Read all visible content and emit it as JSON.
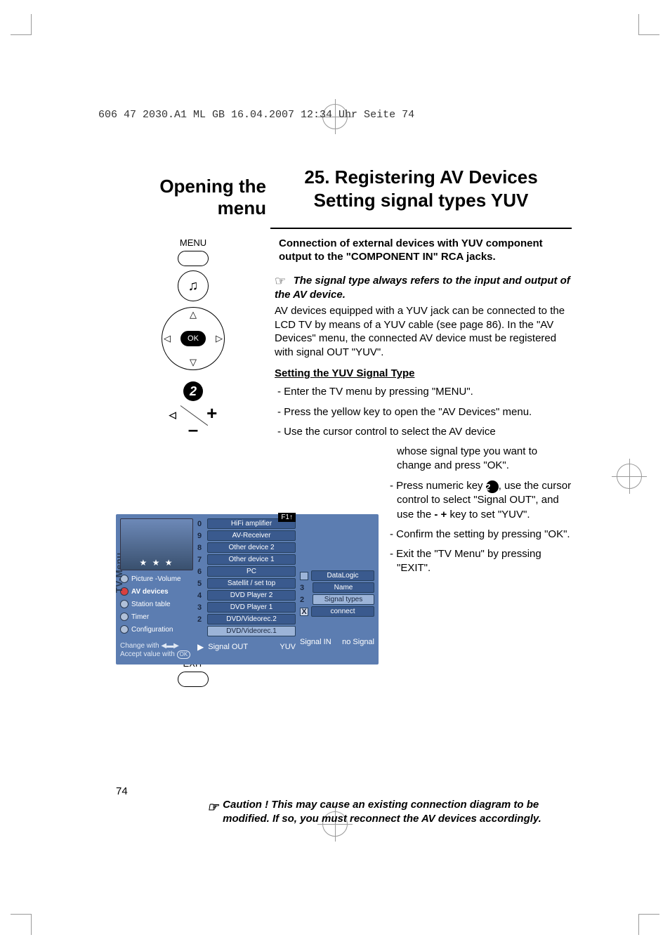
{
  "print_header": "606 47 2030.A1  ML GB  16.04.2007  12:34 Uhr  Seite 74",
  "opening_title": "Opening the menu",
  "chapter_title_1": "25. Registering AV Devices",
  "chapter_title_2": "Setting signal types YUV",
  "intro": "Connection of external devices with YUV component output to the \"COMPONENT IN\" RCA jacks.",
  "remote": {
    "menu": "MENU",
    "ok": "OK",
    "num2": "2",
    "exit": "EXIT",
    "ok_btn": "OK"
  },
  "note1": "The signal type always refers to the input and output of the AV device.",
  "body1": "AV devices equipped with a YUV jack can be connected to the LCD TV by means of a YUV cable (see page 86). In the \"AV Devices\" menu, the connected AV device must be registered with signal OUT \"YUV\".",
  "sub_heading": "Setting the YUV Signal Type",
  "steps": {
    "s1": "- Enter the TV menu by pressing \"MENU\".",
    "s2": "- Press the yellow key to open the \"AV Devices\" menu.",
    "s3a": "- Use the cursor control to select the AV device",
    "s3b": "whose signal type you want to change and press \"OK\".",
    "s4a": "- Press numeric key ",
    "s4b": ", use the cursor control to select \"Signal OUT\", and use the ",
    "s4c": "- +",
    "s4d": " key to set \"YUV\".",
    "s5": "- Confirm the setting by pressing \"OK\".",
    "s6": "- Exit the \"TV Menu\" by pressing \"EXIT\"."
  },
  "osd": {
    "f1": "F1↑",
    "tv_menu": "TV-Menu",
    "stars": "★ ★ ★",
    "sidebar": [
      {
        "label": "Picture -Volume"
      },
      {
        "label": "AV devices",
        "active": true
      },
      {
        "label": "Station table"
      },
      {
        "label": "Timer"
      },
      {
        "label": "Configuration"
      }
    ],
    "device_list": [
      {
        "n": "0",
        "label": "HiFi amplifier"
      },
      {
        "n": "9",
        "label": "AV-Receiver"
      },
      {
        "n": "8",
        "label": "Other device 2"
      },
      {
        "n": "7",
        "label": "Other device 1"
      },
      {
        "n": "6",
        "label": "PC"
      },
      {
        "n": "5",
        "label": "Satellit / set top"
      },
      {
        "n": "4",
        "label": "DVD Player 2"
      },
      {
        "n": "3",
        "label": "DVD Player 1"
      },
      {
        "n": "2",
        "label": "DVD/Videorec.2"
      },
      {
        "n": "",
        "label": "DVD/Videorec.1",
        "sel": true
      }
    ],
    "sub_list": [
      {
        "icon": "sq",
        "label": "DataLogic"
      },
      {
        "n": "3",
        "label": "Name"
      },
      {
        "n": "2",
        "label": "Signal types",
        "sel": true
      },
      {
        "icon": "x",
        "label": "connect"
      }
    ],
    "hint1": "Change with",
    "hint2": "Accept value with",
    "status": {
      "label": "Signal OUT",
      "val1": "YUV",
      "label2": "Signal IN",
      "val2": "no Signal"
    }
  },
  "caution": "Caution !  This may cause an existing connection diagram to be modified. If so, you must reconnect the AV devices accordingly.",
  "page_num": "74"
}
